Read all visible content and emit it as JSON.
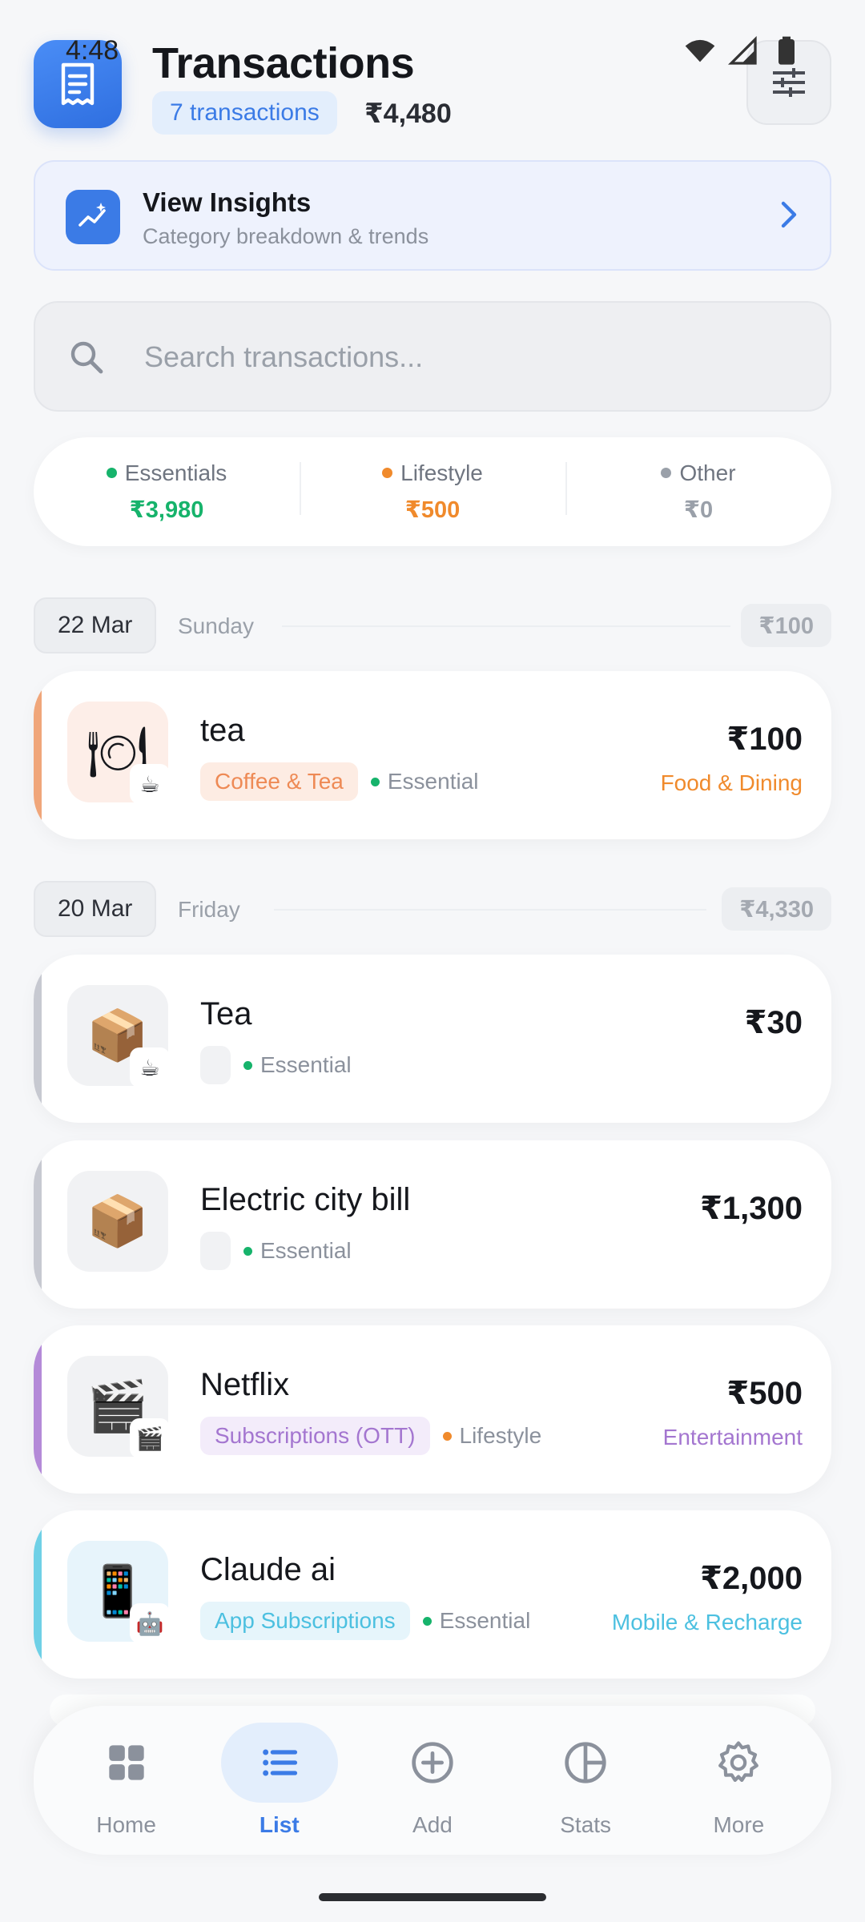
{
  "status_bar": {
    "time": "4:48"
  },
  "header": {
    "title": "Transactions",
    "count_label": "7 transactions",
    "total": "₹4,480"
  },
  "insights": {
    "title": "View Insights",
    "subtitle": "Category breakdown & trends"
  },
  "search": {
    "placeholder": "Search transactions..."
  },
  "summary": [
    {
      "label": "Essentials",
      "value": "₹3,980",
      "color": "#16b36b"
    },
    {
      "label": "Lifestyle",
      "value": "₹500",
      "color": "#f08a2c"
    },
    {
      "label": "Other",
      "value": "₹0",
      "color": "#9aa0a9"
    }
  ],
  "groups": [
    {
      "date": "22 Mar",
      "day": "Sunday",
      "total": "₹100"
    },
    {
      "date": "20 Mar",
      "day": "Friday",
      "total": "₹4,330"
    }
  ],
  "transactions": [
    {
      "title": "tea",
      "tag": "Coffee & Tea",
      "kind": "Essential",
      "amount": "₹100",
      "category": "Food & Dining",
      "icon": "plate-icon",
      "accent": "#f0a67a",
      "cat_color": "#f08a2c"
    },
    {
      "title": "Tea",
      "tag": "",
      "kind": "Essential",
      "amount": "₹30",
      "category": "",
      "icon": "package-icon",
      "accent": "#c7c9d1",
      "cat_color": "#9aa0a9"
    },
    {
      "title": "Electric city bill",
      "tag": "",
      "kind": "Essential",
      "amount": "₹1,300",
      "category": "",
      "icon": "package-icon",
      "accent": "#c7c9d1",
      "cat_color": "#9aa0a9"
    },
    {
      "title": "Netflix",
      "tag": "Subscriptions (OTT)",
      "kind": "Lifestyle",
      "amount": "₹500",
      "category": "Entertainment",
      "icon": "clapper-icon",
      "accent": "#b48ad8",
      "cat_color": "#a476d0"
    },
    {
      "title": "Claude ai",
      "tag": "App Subscriptions",
      "kind": "Essential",
      "amount": "₹2,000",
      "category": "Mobile & Recharge",
      "icon": "phone-icon",
      "accent": "#6fd0e6",
      "cat_color": "#4cc0e0"
    }
  ],
  "nav": [
    {
      "label": "Home",
      "icon": "grid-icon"
    },
    {
      "label": "List",
      "icon": "list-icon",
      "active": true
    },
    {
      "label": "Add",
      "icon": "plus-circle-icon"
    },
    {
      "label": "Stats",
      "icon": "pie-icon"
    },
    {
      "label": "More",
      "icon": "gear-icon"
    }
  ]
}
